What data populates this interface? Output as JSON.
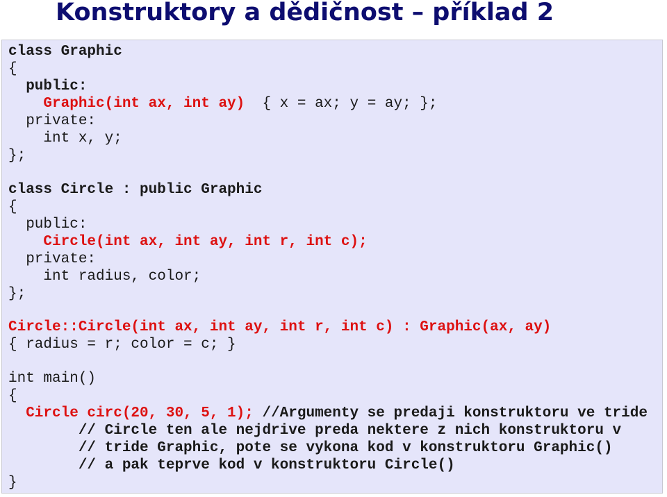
{
  "title": "Konstruktory a dědičnost – příklad 2",
  "code": {
    "l1": "class Graphic",
    "l2": "{",
    "l3": "  public:",
    "l4a": "    Graphic(int ax, int ay)",
    "l4b": "  { x = ax; y = ay; };",
    "l5": "  private:",
    "l6": "    int x, y;",
    "l7": "};",
    "l8": "class Circle : public Graphic",
    "l9": "{",
    "l10": "  public:",
    "l11": "    Circle(int ax, int ay, int r, int c);",
    "l12": "  private:",
    "l13": "    int radius, color;",
    "l14": "};",
    "l15": "Circle::Circle(int ax, int ay, int r, int c) : Graphic(ax, ay)",
    "l16": "{ radius = r; color = c; }",
    "l17": "int main()",
    "l18": "{",
    "l19a": "  Circle circ(20, 30, 5, 1);",
    "l19b": " //Argumenty se predaji konstruktoru ve tride",
    "l20": "        // Circle ten ale nejdrive preda nektere z nich konstruktoru v",
    "l21": "        // tride Graphic, pote se vykona kod v konstruktoru Graphic()",
    "l22": "        // a pak teprve kod v konstruktoru Circle()",
    "l23": "}"
  }
}
